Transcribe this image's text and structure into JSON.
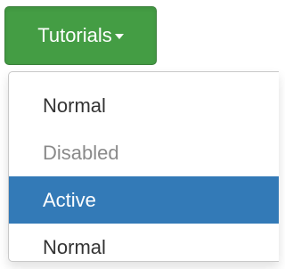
{
  "button": {
    "label": "Tutorials",
    "color": "#449d44"
  },
  "menu": {
    "items": [
      {
        "label": "Normal",
        "state": "normal"
      },
      {
        "label": "Disabled",
        "state": "disabled"
      },
      {
        "label": "Active",
        "state": "active"
      },
      {
        "label": "Normal",
        "state": "normal"
      }
    ],
    "active_color": "#337ab7"
  }
}
